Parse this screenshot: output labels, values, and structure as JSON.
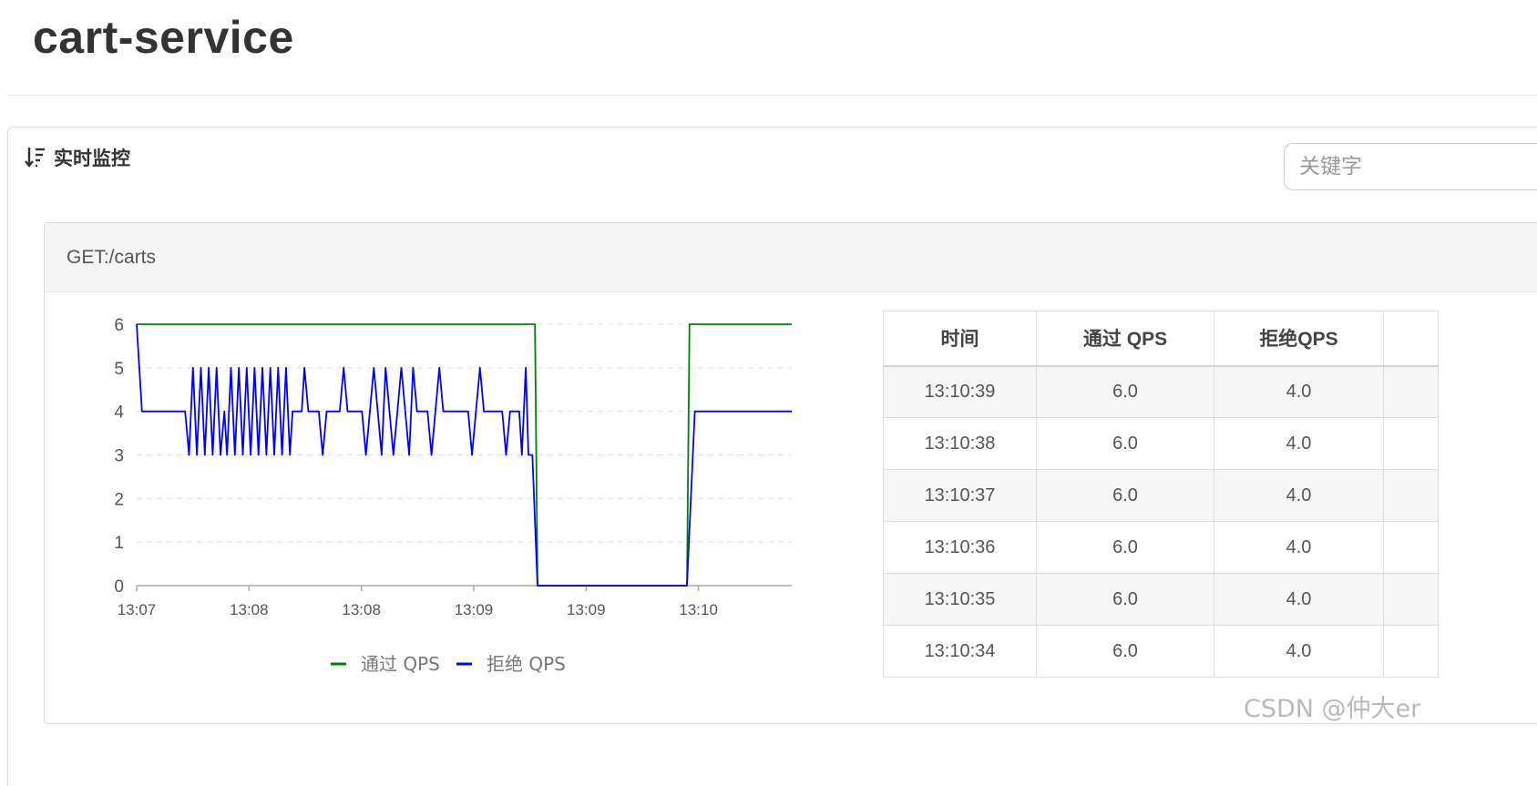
{
  "page": {
    "title": "cart-service"
  },
  "panel": {
    "title": "实时监控",
    "sort_icon": "sort-descending-icon"
  },
  "search": {
    "placeholder": "关键字"
  },
  "resource": {
    "name": "GET:/carts"
  },
  "chart_data": {
    "type": "line",
    "x_ticks": [
      "13:07",
      "13:08",
      "13:08",
      "13:09",
      "13:09",
      "13:10"
    ],
    "y_ticks": [
      0,
      1,
      2,
      3,
      4,
      5,
      6
    ],
    "ylim": [
      0,
      6
    ],
    "xlim": [
      0,
      100
    ],
    "grid": true,
    "legend": "bottom",
    "series": [
      {
        "name": "通过 QPS",
        "color": "#008000",
        "points": [
          [
            0,
            6
          ],
          [
            60.8,
            6
          ],
          [
            61.2,
            0
          ],
          [
            84.0,
            0
          ],
          [
            84.4,
            6
          ],
          [
            100,
            6
          ]
        ]
      },
      {
        "name": "拒绝 QPS",
        "color": "#0000ff",
        "points": [
          [
            0,
            6
          ],
          [
            0.8,
            4
          ],
          [
            7.4,
            4
          ],
          [
            8.0,
            3
          ],
          [
            8.6,
            5
          ],
          [
            9.2,
            3
          ],
          [
            9.8,
            5
          ],
          [
            10.4,
            3
          ],
          [
            11.0,
            5
          ],
          [
            11.6,
            3
          ],
          [
            12.2,
            5
          ],
          [
            12.8,
            3
          ],
          [
            13.4,
            4
          ],
          [
            13.8,
            3
          ],
          [
            14.4,
            5
          ],
          [
            15.0,
            3
          ],
          [
            15.6,
            5
          ],
          [
            16.2,
            3
          ],
          [
            16.8,
            5
          ],
          [
            17.4,
            3
          ],
          [
            18.0,
            5
          ],
          [
            18.6,
            3
          ],
          [
            19.2,
            5
          ],
          [
            19.8,
            3
          ],
          [
            20.4,
            5
          ],
          [
            21.0,
            3
          ],
          [
            21.6,
            5
          ],
          [
            22.2,
            3
          ],
          [
            22.8,
            5
          ],
          [
            23.4,
            3
          ],
          [
            23.8,
            4
          ],
          [
            25.2,
            4
          ],
          [
            25.6,
            5
          ],
          [
            26.2,
            4
          ],
          [
            27.8,
            4
          ],
          [
            28.4,
            3
          ],
          [
            29.0,
            4
          ],
          [
            31.0,
            4
          ],
          [
            31.6,
            5
          ],
          [
            32.2,
            4
          ],
          [
            34.4,
            4
          ],
          [
            35.0,
            3
          ],
          [
            35.6,
            4
          ],
          [
            36.2,
            5
          ],
          [
            36.8,
            4
          ],
          [
            37.4,
            3
          ],
          [
            38.0,
            5
          ],
          [
            38.6,
            4
          ],
          [
            39.2,
            3
          ],
          [
            39.8,
            4
          ],
          [
            40.4,
            5
          ],
          [
            41.0,
            4
          ],
          [
            41.6,
            3
          ],
          [
            42.2,
            5
          ],
          [
            42.8,
            4
          ],
          [
            43.4,
            4
          ],
          [
            44.4,
            4
          ],
          [
            45.0,
            3
          ],
          [
            45.6,
            4
          ],
          [
            46.2,
            5
          ],
          [
            46.8,
            4
          ],
          [
            50.0,
            4
          ],
          [
            50.6,
            4
          ],
          [
            51.2,
            3
          ],
          [
            51.8,
            4
          ],
          [
            52.4,
            5
          ],
          [
            53.0,
            4
          ],
          [
            55.8,
            4
          ],
          [
            56.4,
            3
          ],
          [
            57.0,
            4
          ],
          [
            58.4,
            4
          ],
          [
            58.8,
            3
          ],
          [
            59.4,
            5
          ],
          [
            59.8,
            3
          ],
          [
            60.4,
            3
          ],
          [
            61.2,
            0
          ],
          [
            84.0,
            0
          ],
          [
            84.6,
            2
          ],
          [
            85.2,
            4
          ],
          [
            100,
            4
          ]
        ]
      }
    ]
  },
  "table": {
    "headers": [
      "时间",
      "通过 QPS",
      "拒绝QPS"
    ],
    "rows": [
      [
        "13:10:39",
        "6.0",
        "4.0"
      ],
      [
        "13:10:38",
        "6.0",
        "4.0"
      ],
      [
        "13:10:37",
        "6.0",
        "4.0"
      ],
      [
        "13:10:36",
        "6.0",
        "4.0"
      ],
      [
        "13:10:35",
        "6.0",
        "4.0"
      ],
      [
        "13:10:34",
        "6.0",
        "4.0"
      ]
    ]
  },
  "watermark": "CSDN @仲大er"
}
